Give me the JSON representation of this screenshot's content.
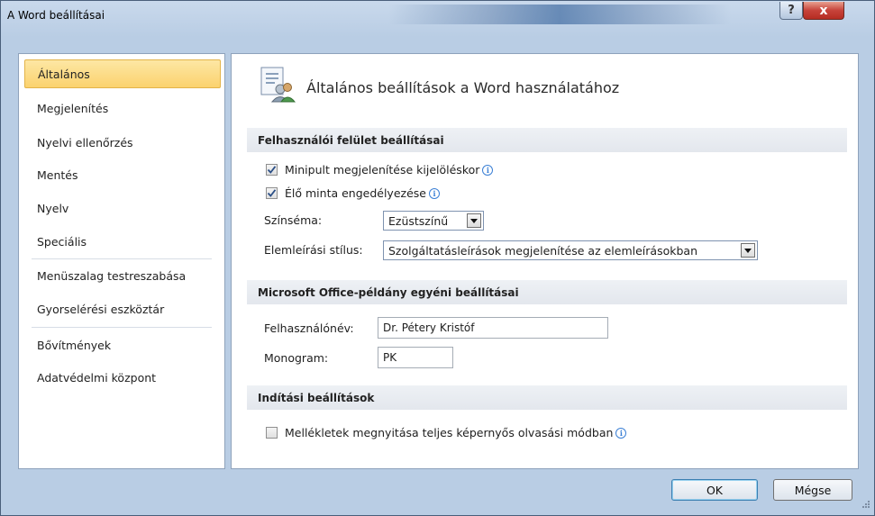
{
  "window": {
    "title": "A Word beállításai"
  },
  "caption": {
    "help": "?",
    "close": "x"
  },
  "sidebar": {
    "items": [
      {
        "label": "Általános"
      },
      {
        "label": "Megjelenítés"
      },
      {
        "label": "Nyelvi ellenőrzés"
      },
      {
        "label": "Mentés"
      },
      {
        "label": "Nyelv"
      },
      {
        "label": "Speciális"
      },
      {
        "label": "Menüszalag testreszabása"
      },
      {
        "label": "Gyorselérési eszköztár"
      },
      {
        "label": "Bővítmények"
      },
      {
        "label": "Adatvédelmi központ"
      }
    ],
    "selected": "Általános"
  },
  "main": {
    "header": "Általános beállítások a Word használatához",
    "ui_section": {
      "title": "Felhasználói felület beállításai",
      "minitoolbar": {
        "label": "Minipult megjelenítése kijelöléskor",
        "checked": true
      },
      "livepreview": {
        "label": "Élő minta engedélyezése",
        "checked": true
      },
      "colorscheme": {
        "label": "Színséma:",
        "value": "Ezüstszínű"
      },
      "screentip": {
        "label": "Elemleírási stílus:",
        "value": "Szolgáltatásleírások megjelenítése az elemleírásokban"
      }
    },
    "office_section": {
      "title": "Microsoft Office-példány egyéni beállításai",
      "username": {
        "label": "Felhasználónév:",
        "value": "Dr. Pétery Kristóf"
      },
      "initials": {
        "label": "Monogram:",
        "value": "PK"
      }
    },
    "startup_section": {
      "title": "Indítási beállítások",
      "fullscreen": {
        "label": "Mellékletek megnyitása teljes képernyős olvasási módban",
        "checked": false
      }
    }
  },
  "footer": {
    "ok": "OK",
    "cancel": "Mégse"
  },
  "info_glyph": "i"
}
